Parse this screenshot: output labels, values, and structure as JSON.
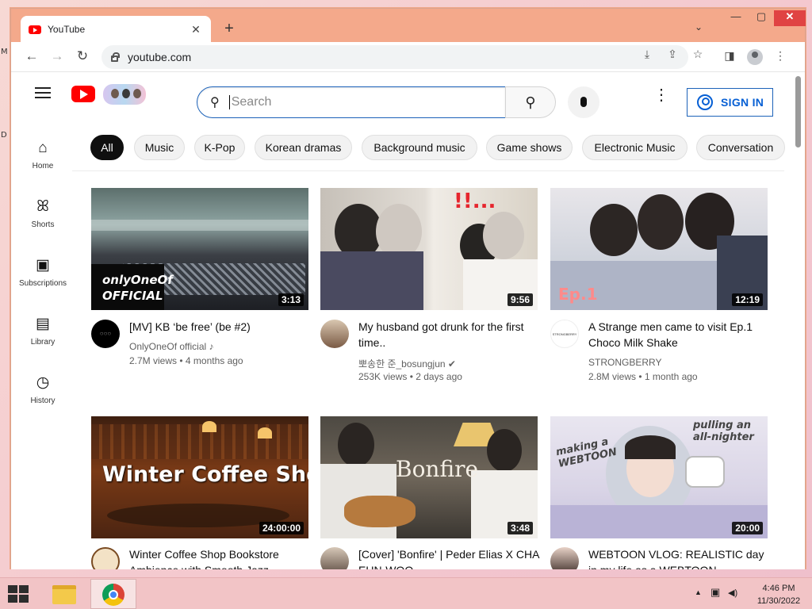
{
  "desktop": {
    "glyph_top": "M",
    "glyph_bottom": "D"
  },
  "browser": {
    "tab_title": "YouTube",
    "tab_close": "✕",
    "new_tab": "+",
    "tab_search": "⌄",
    "minimize": "—",
    "maximize": "▢",
    "close": "✕",
    "back": "←",
    "forward": "→",
    "reload": "↻",
    "url": "youtube.com",
    "install": "⤓",
    "share": "⇪",
    "bookmark": "☆",
    "side_panel": "◨",
    "menu": "⋮"
  },
  "youtube": {
    "search_placeholder": "Search",
    "search_icon": "⚲",
    "more_icon": "⋮",
    "sign_in": "SIGN IN",
    "guide": [
      {
        "label": "Home",
        "icon": "⌂"
      },
      {
        "label": "Shorts",
        "icon": "ꕤ"
      },
      {
        "label": "Subscriptions",
        "icon": "▣"
      },
      {
        "label": "Library",
        "icon": "▤"
      },
      {
        "label": "History",
        "icon": "◷"
      }
    ],
    "chips": [
      "All",
      "Music",
      "K-Pop",
      "Korean dramas",
      "Background music",
      "Game shows",
      "Electronic Music",
      "Conversation"
    ],
    "videos": [
      {
        "title": "[MV] KB ‘be free’ (be #2)",
        "channel": "OnlyOneOf official ♪",
        "meta": "2.7M views • 4 months ago",
        "duration": "3:13",
        "thumb_text": "onlyOneOf\nOFFICIAL",
        "avatar_text": "○○○"
      },
      {
        "title": "My husband got drunk for the first time..",
        "channel": "뽀송한 준_bosungjun ✔",
        "meta": "253K views • 2 days ago",
        "duration": "9:56",
        "thumb_text": "!!...",
        "avatar_text": ""
      },
      {
        "title": "A Strange men came to visit Ep.1 Choco Milk Shake",
        "channel": "STRONGBERRY",
        "meta": "2.8M views • 1 month ago",
        "duration": "12:19",
        "thumb_text": "Ep.1",
        "avatar_text": "STRONGBERRY"
      },
      {
        "title": "Winter Coffee Shop Bookstore Ambience with Smooth Jazz",
        "channel": "",
        "meta": "",
        "duration": "24:00:00",
        "thumb_text": "Winter Coffee Shop",
        "avatar_text": ""
      },
      {
        "title": "[Cover] 'Bonfire' | Peder Elias X CHA EUN-WOO",
        "channel": "",
        "meta": "",
        "duration": "3:48",
        "thumb_text": "Bonfire",
        "avatar_text": ""
      },
      {
        "title": "WEBTOON VLOG: REALISTIC day in my life as a WEBTOON",
        "channel": "",
        "meta": "",
        "duration": "20:00",
        "thumb_text": "making a WEBTOON",
        "thumb_text2": "pulling an all-nighter",
        "avatar_text": ""
      }
    ]
  },
  "taskbar": {
    "tray_arrow": "▲",
    "tray_network": "▣",
    "tray_volume": "◀)",
    "time": "4:46 PM",
    "date": "11/30/2022"
  }
}
